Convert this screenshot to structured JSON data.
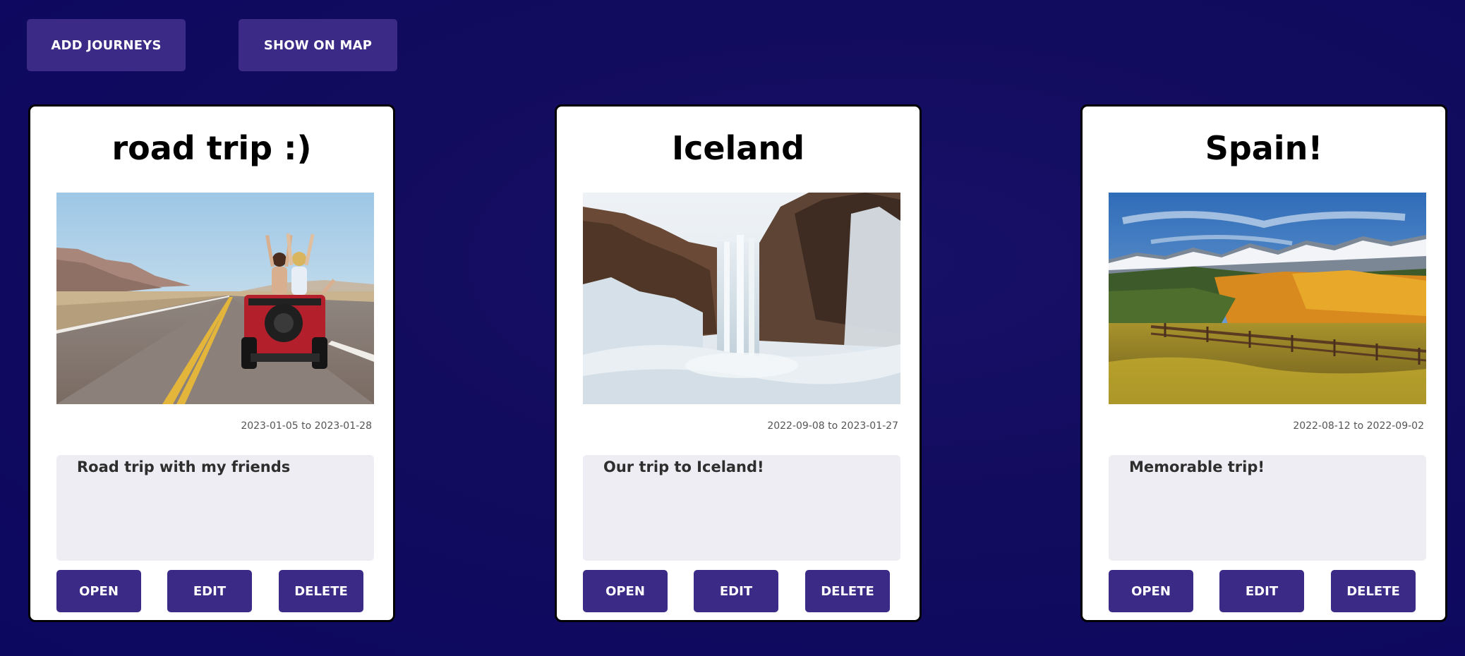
{
  "toolbar": {
    "add_label": "ADD JOURNEYS",
    "map_label": "SHOW ON MAP"
  },
  "journeys": [
    {
      "title": "road trip :)",
      "image": "road-trip-jeep-photo",
      "dates": "2023-01-05 to 2023-01-28",
      "description": "Road trip with my friends",
      "open_label": "OPEN",
      "edit_label": "EDIT",
      "delete_label": "DELETE"
    },
    {
      "title": "Iceland",
      "image": "frozen-waterfall-photo",
      "dates": "2022-09-08 to 2023-01-27",
      "description": "Our trip to Iceland!",
      "open_label": "OPEN",
      "edit_label": "EDIT",
      "delete_label": "DELETE"
    },
    {
      "title": "Spain!",
      "image": "mountain-autumn-landscape-photo",
      "dates": "2022-08-12 to 2022-09-02",
      "description": "Memorable trip!",
      "open_label": "OPEN",
      "edit_label": "EDIT",
      "delete_label": "DELETE"
    }
  ],
  "colors": {
    "background": "#120c5e",
    "button": "#3c2a87",
    "card": "#ffffff",
    "description_box": "#eeedf3"
  }
}
